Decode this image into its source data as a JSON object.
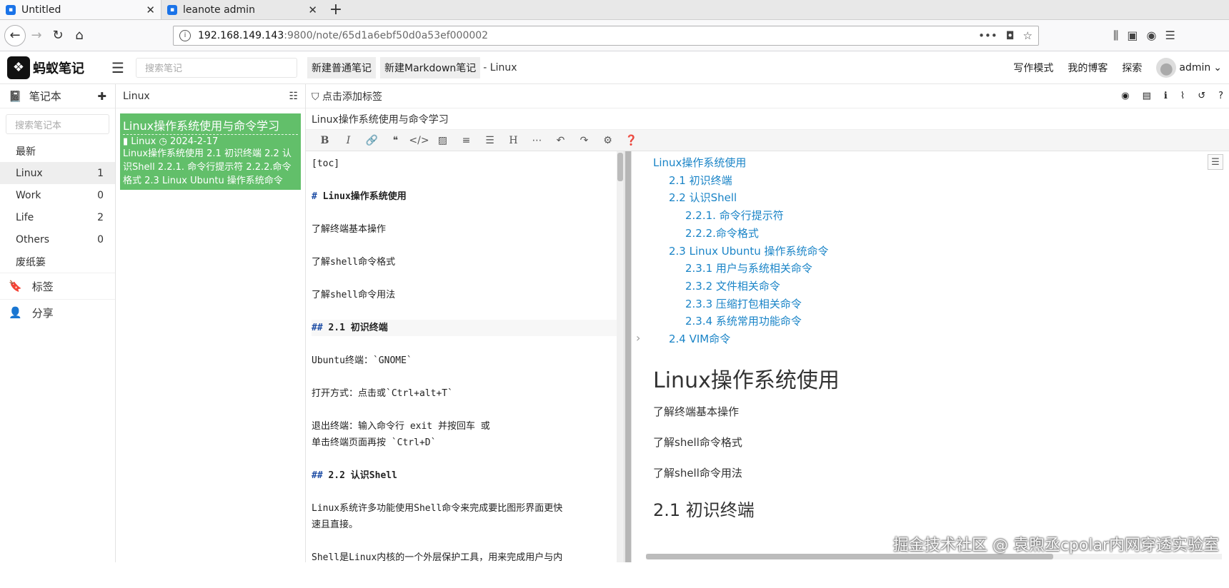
{
  "browser": {
    "tabs": [
      {
        "title": "Untitled",
        "active": true
      },
      {
        "title": "leanote admin",
        "active": false
      }
    ],
    "url_host": "192.168.149.143",
    "url_path": ":9800/note/65d1a6ebf50d0a53ef000002"
  },
  "header": {
    "logo_text": "蚂蚁笔记",
    "search_placeholder": "搜索笔记",
    "new_note": "新建普通笔记",
    "new_markdown": "新建Markdown笔记",
    "breadcrumb": "- Linux",
    "write_mode": "写作模式",
    "my_blog": "我的博客",
    "explore": "探索",
    "user": "admin"
  },
  "sidebar": {
    "title": "笔记本",
    "search_placeholder": "搜索笔记本",
    "items": [
      {
        "name": "最新",
        "count": ""
      },
      {
        "name": "Linux",
        "count": "1"
      },
      {
        "name": "Work",
        "count": "0"
      },
      {
        "name": "Life",
        "count": "2"
      },
      {
        "name": "Others",
        "count": "0"
      },
      {
        "name": "废纸篓",
        "count": ""
      }
    ],
    "tags": "标签",
    "share": "分享"
  },
  "notelist": {
    "title": "Linux",
    "note": {
      "title": "Linux操作系统使用与命令学习",
      "notebook": "Linux",
      "date": "2024-2-17",
      "desc": "Linux操作系统使用 2.1 初识终端 2.2 认识Shell 2.2.1. 命令行提示符 2.2.2.命令格式 2.3 Linux Ubuntu 操作系统命令"
    }
  },
  "editor": {
    "add_tag": "点击添加标签",
    "note_title": "Linux操作系统使用与命令学习",
    "source": {
      "toc": "[toc]",
      "h1_hash": "#",
      "h1_text": " Linux操作系统使用",
      "p1": "了解终端基本操作",
      "p2": "了解shell命令格式",
      "p3": "了解shell命令用法",
      "h2a_hash": "##",
      "h2a_text": " 2.1 初识终端",
      "p4": "Ubuntu终端：`GNOME`",
      "p5": "打开方式：点击或`Ctrl+alt+T`",
      "p6a": "退出终端：输入命令行 exit 并按回车 或",
      "p6b": "单击终端页面再按 `Ctrl+D`",
      "h2b_hash": "##",
      "h2b_text": " 2.2 认识Shell",
      "p7a": "Linux系统许多功能使用Shell命令来完成要比图形界面更快",
      "p7b": "速且直接。",
      "p8": "Shell是Linux内核的一个外层保护工具，用来完成用户与内"
    },
    "toc": [
      {
        "text": "Linux操作系统使用",
        "level": 0
      },
      {
        "text": "2.1 初识终端",
        "level": 1
      },
      {
        "text": "2.2 认识Shell",
        "level": 1
      },
      {
        "text": "2.2.1. 命令行提示符",
        "level": 2
      },
      {
        "text": "2.2.2.命令格式",
        "level": 2
      },
      {
        "text": "2.3 Linux Ubuntu 操作系统命令",
        "level": 1
      },
      {
        "text": "2.3.1 用户与系统相关命令",
        "level": 2
      },
      {
        "text": "2.3.2 文件相关命令",
        "level": 2
      },
      {
        "text": "2.3.3 压缩打包相关命令",
        "level": 2
      },
      {
        "text": "2.3.4 系统常用功能命令",
        "level": 2
      },
      {
        "text": "2.4 VIM命令",
        "level": 1
      }
    ],
    "preview": {
      "h1": "Linux操作系统使用",
      "p1": "了解终端基本操作",
      "p2": "了解shell命令格式",
      "p3": "了解shell命令用法",
      "h2": "2.1 初识终端"
    }
  },
  "watermark": "掘金技术社区 @ 袁煦丞cpolar内网穿透实验室"
}
